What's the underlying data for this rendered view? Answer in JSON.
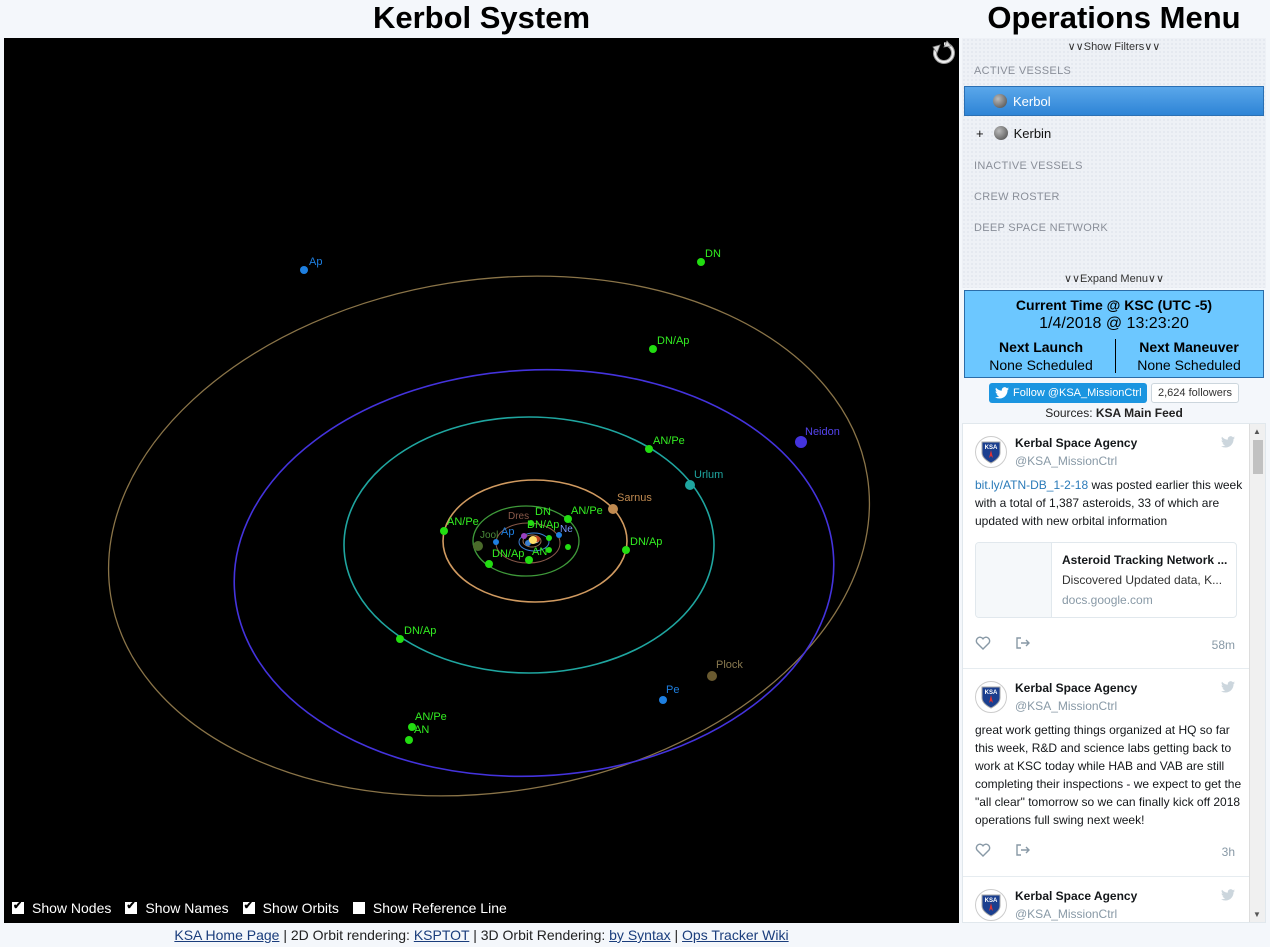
{
  "header": {
    "left_title": "Kerbol System",
    "right_title": "Operations Menu"
  },
  "orbit_view": {
    "labels": {
      "ap_outer": "Ap",
      "dn_outer": "DN",
      "dnap_1": "DN/Ap",
      "neidon": "Neidon",
      "anpe_1": "AN/Pe",
      "urlum": "Urlum",
      "sarnus": "Sarnus",
      "anpe_2": "AN/Pe",
      "anpe_3": "AN/Pe",
      "dnap_2": "DN/Ap",
      "dn_inner": "DN",
      "dnap_3": "DN/Ap",
      "dres": "Dres",
      "jool": "Jool",
      "ap_inner": "Ap",
      "an_inner": "AN",
      "ne_inner": "Ne",
      "dnap_4": "DN/Ap",
      "plock": "Plock",
      "pe": "Pe",
      "anpe_4": "AN/Pe",
      "an_outer": "AN"
    },
    "colors": {
      "outer_orbit": "#8a7448",
      "neidon_orbit": "#4433dd",
      "urlum_orbit": "#1fa6a0",
      "sarnus_orbit": "#d09a60",
      "jool_orbit": "#3f9a3a",
      "node_marker": "#22dd11",
      "node_label": "#33ee22",
      "apsis_marker": "#1e7fe0"
    },
    "controls": {
      "show_nodes": "Show Nodes",
      "show_names": "Show Names",
      "show_orbits": "Show Orbits",
      "show_reference_line": "Show Reference Line"
    }
  },
  "ops_menu": {
    "show_filters": "∨∨Show Filters∨∨",
    "active_vessels": "ACTIVE VESSELS",
    "item_kerbol": "Kerbol",
    "item_kerbin": "Kerbin",
    "expand_plus": "+",
    "inactive_vessels": "INACTIVE VESSELS",
    "crew_roster": "CREW ROSTER",
    "deep_space_network": "DEEP SPACE NETWORK",
    "expand_menu": "∨∨Expand Menu∨∨"
  },
  "clock": {
    "label": "Current Time @ KSC (UTC -5)",
    "value": "1/4/2018 @ 13:23:20",
    "next_launch_label": "Next Launch",
    "next_launch_value": "None Scheduled",
    "next_maneuver_label": "Next Maneuver",
    "next_maneuver_value": "None Scheduled"
  },
  "twitter": {
    "follow_label": "Follow @KSA_MissionCtrl",
    "followers": "2,624 followers",
    "sources_prefix": "Sources:",
    "sources_value": "KSA Main Feed",
    "tweets": [
      {
        "name": "Kerbal Space Agency",
        "handle": "@KSA_MissionCtrl",
        "link": "bit.ly/ATN-DB_1-2-18",
        "text": " was posted earlier this week with a total of 1,387 asteroids, 33 of which are updated with new orbital information",
        "card_title": "Asteroid Tracking Network ...",
        "card_desc": "Discovered Updated data, K...",
        "card_domain": "docs.google.com",
        "time": "58m"
      },
      {
        "name": "Kerbal Space Agency",
        "handle": "@KSA_MissionCtrl",
        "text": "great work getting things organized at HQ so far this week, R&D and science labs getting back to work at KSC today while HAB and VAB are still completing their inspections - we expect to get the \"all clear\" tomorrow so we can finally kick off 2018 operations full swing next week!",
        "time": "3h"
      },
      {
        "name": "Kerbal Space Agency",
        "handle": "@KSA_MissionCtrl"
      }
    ]
  },
  "footer": {
    "home_link": "KSA Home Page",
    "sep1": " | 2D Orbit rendering: ",
    "ksptot_link": "KSPTOT",
    "sep2": " | 3D Orbit Rendering: ",
    "syntax_link": "by Syntax",
    "sep3": " | ",
    "wiki_link": "Ops Tracker Wiki"
  }
}
